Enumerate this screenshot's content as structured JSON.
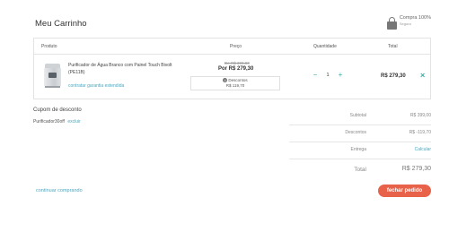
{
  "header": {
    "title": "Meu Carrinho",
    "secure_title": "Compra 100%",
    "secure_sub": "Segura"
  },
  "table": {
    "headers": {
      "product": "Produto",
      "price": "Preço",
      "quantity": "Quantidade",
      "total": "Total"
    },
    "item": {
      "name": "Purificador de Água Branco com Painel Touch Bivolt (PE11B)",
      "warranty_link": "contratar garantia estendida",
      "old_price": "De R$ 399,00",
      "new_price": "Por R$ 279,30",
      "discount_label": "Descontos",
      "discount_value": "R$ 119,70",
      "quantity": "1",
      "decrement": "−",
      "increment": "+",
      "total": "R$ 279,30",
      "remove": "×"
    }
  },
  "coupon": {
    "title": "Cupom de desconto",
    "code": "Purificador30off",
    "remove_label": "excluir"
  },
  "summary": {
    "subtotal_label": "Subtotal",
    "subtotal_value": "R$ 399,00",
    "discounts_label": "Descontos",
    "discounts_value": "R$ -119,70",
    "shipping_label": "Entrega",
    "shipping_value": "Calcular",
    "total_label": "Total",
    "total_value": "R$ 279,30"
  },
  "actions": {
    "continue": "continuar comprando",
    "checkout": "fechar pedido"
  },
  "colors": {
    "accent": "#4aa8c0",
    "qty_controls": "#2fb0a8",
    "checkout": "#e8624a"
  }
}
